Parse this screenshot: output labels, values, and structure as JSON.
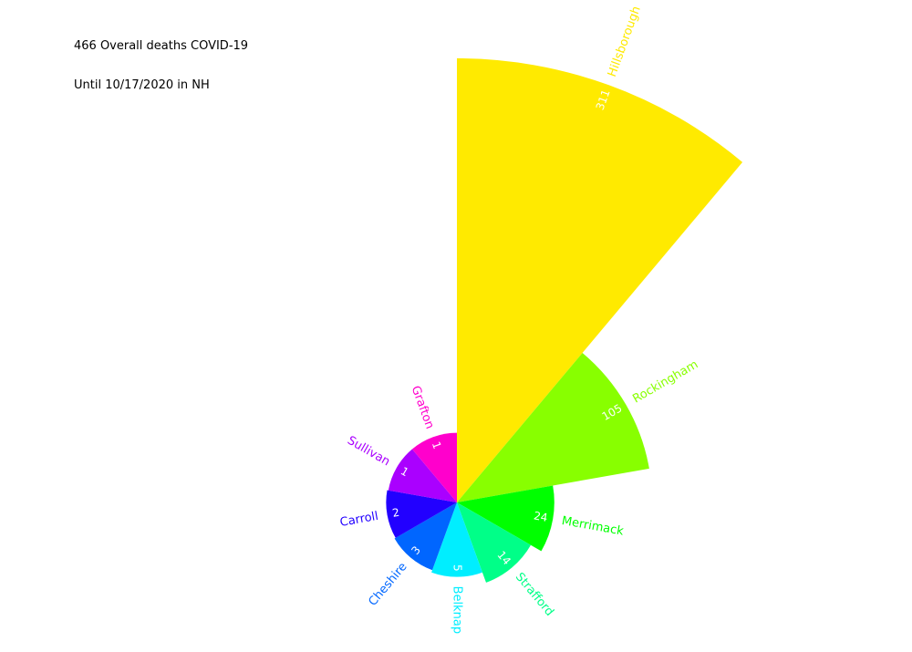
{
  "chart_data": {
    "type": "polar-bar",
    "title_line1": "466 Overall deaths COVID-19",
    "title_line2": "Until 10/17/2020 in NH",
    "categories": [
      "Hillsborough",
      "Rockingham",
      "Merrimack",
      "Strafford",
      "Belknap",
      "Cheshire",
      "Carroll",
      "Sullivan",
      "Grafton"
    ],
    "values": [
      311,
      105,
      24,
      14,
      5,
      3,
      2,
      1,
      1
    ],
    "colors": [
      "#ffea00",
      "#88ff00",
      "#00ff00",
      "#00ff88",
      "#00eeff",
      "#0066ff",
      "#2200ff",
      "#aa00ff",
      "#ff00cc"
    ],
    "grid": false,
    "legend": "none"
  }
}
